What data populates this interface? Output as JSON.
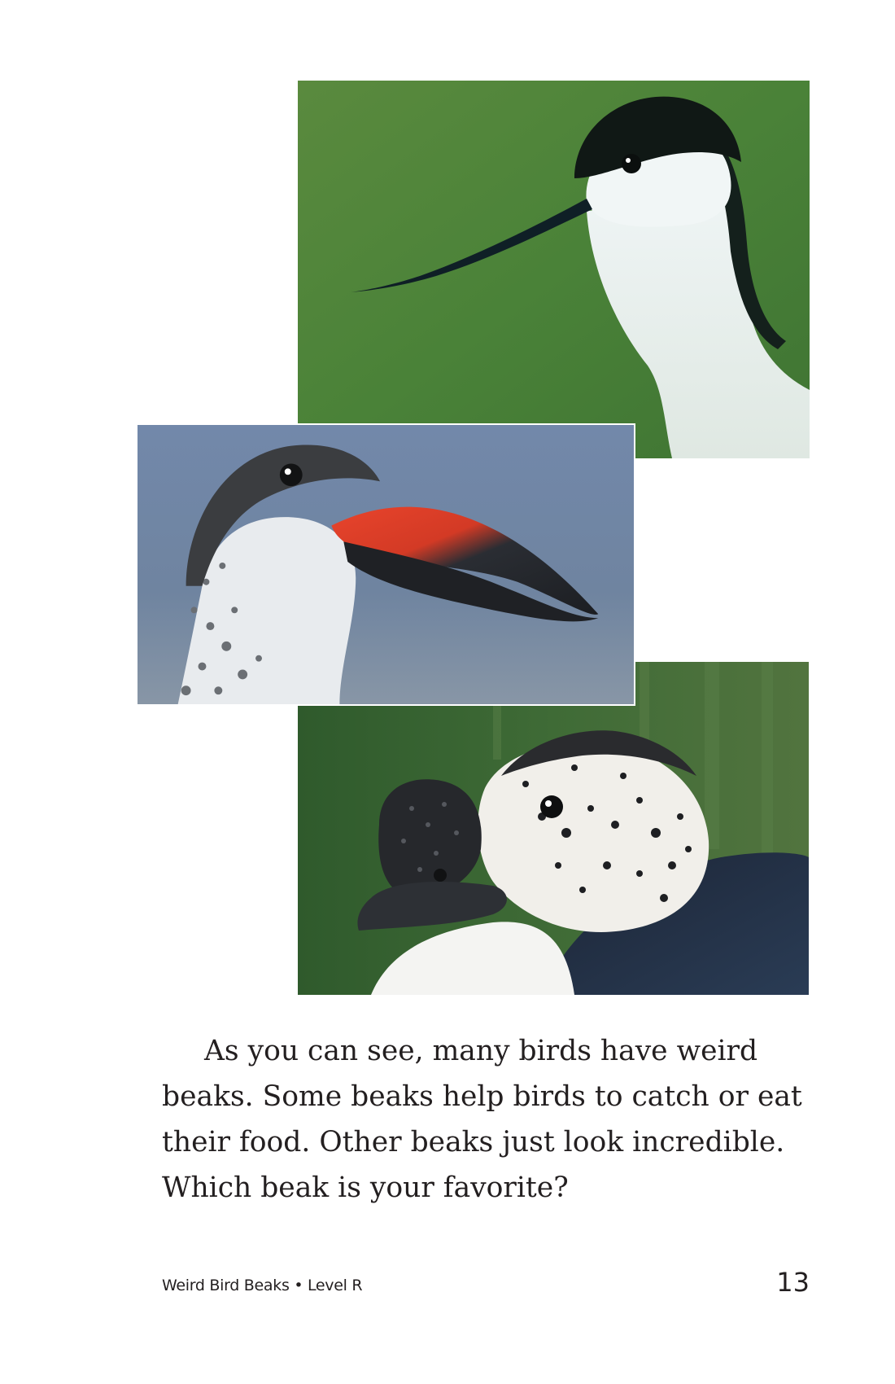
{
  "photos": {
    "avocet": {
      "label": "avocet-photo"
    },
    "skimmer": {
      "label": "skimmer-photo"
    },
    "comb_duck": {
      "label": "comb-duck-photo"
    }
  },
  "body": {
    "lines": [
      "As you can see, many birds have weird",
      "beaks. Some beaks help birds to catch or eat",
      "their food. Other beaks just look incredible.",
      "Which beak is your favorite?"
    ]
  },
  "footer": {
    "title": "Weird Bird Beaks • Level R",
    "page_number": "13"
  },
  "colors": {
    "text": "#231f20",
    "avocet_background": "#4f8a3a",
    "skimmer_background": "#6f86a8",
    "skimmer_beak": "#e2402a",
    "comb_duck_background": "#3f6a35"
  }
}
